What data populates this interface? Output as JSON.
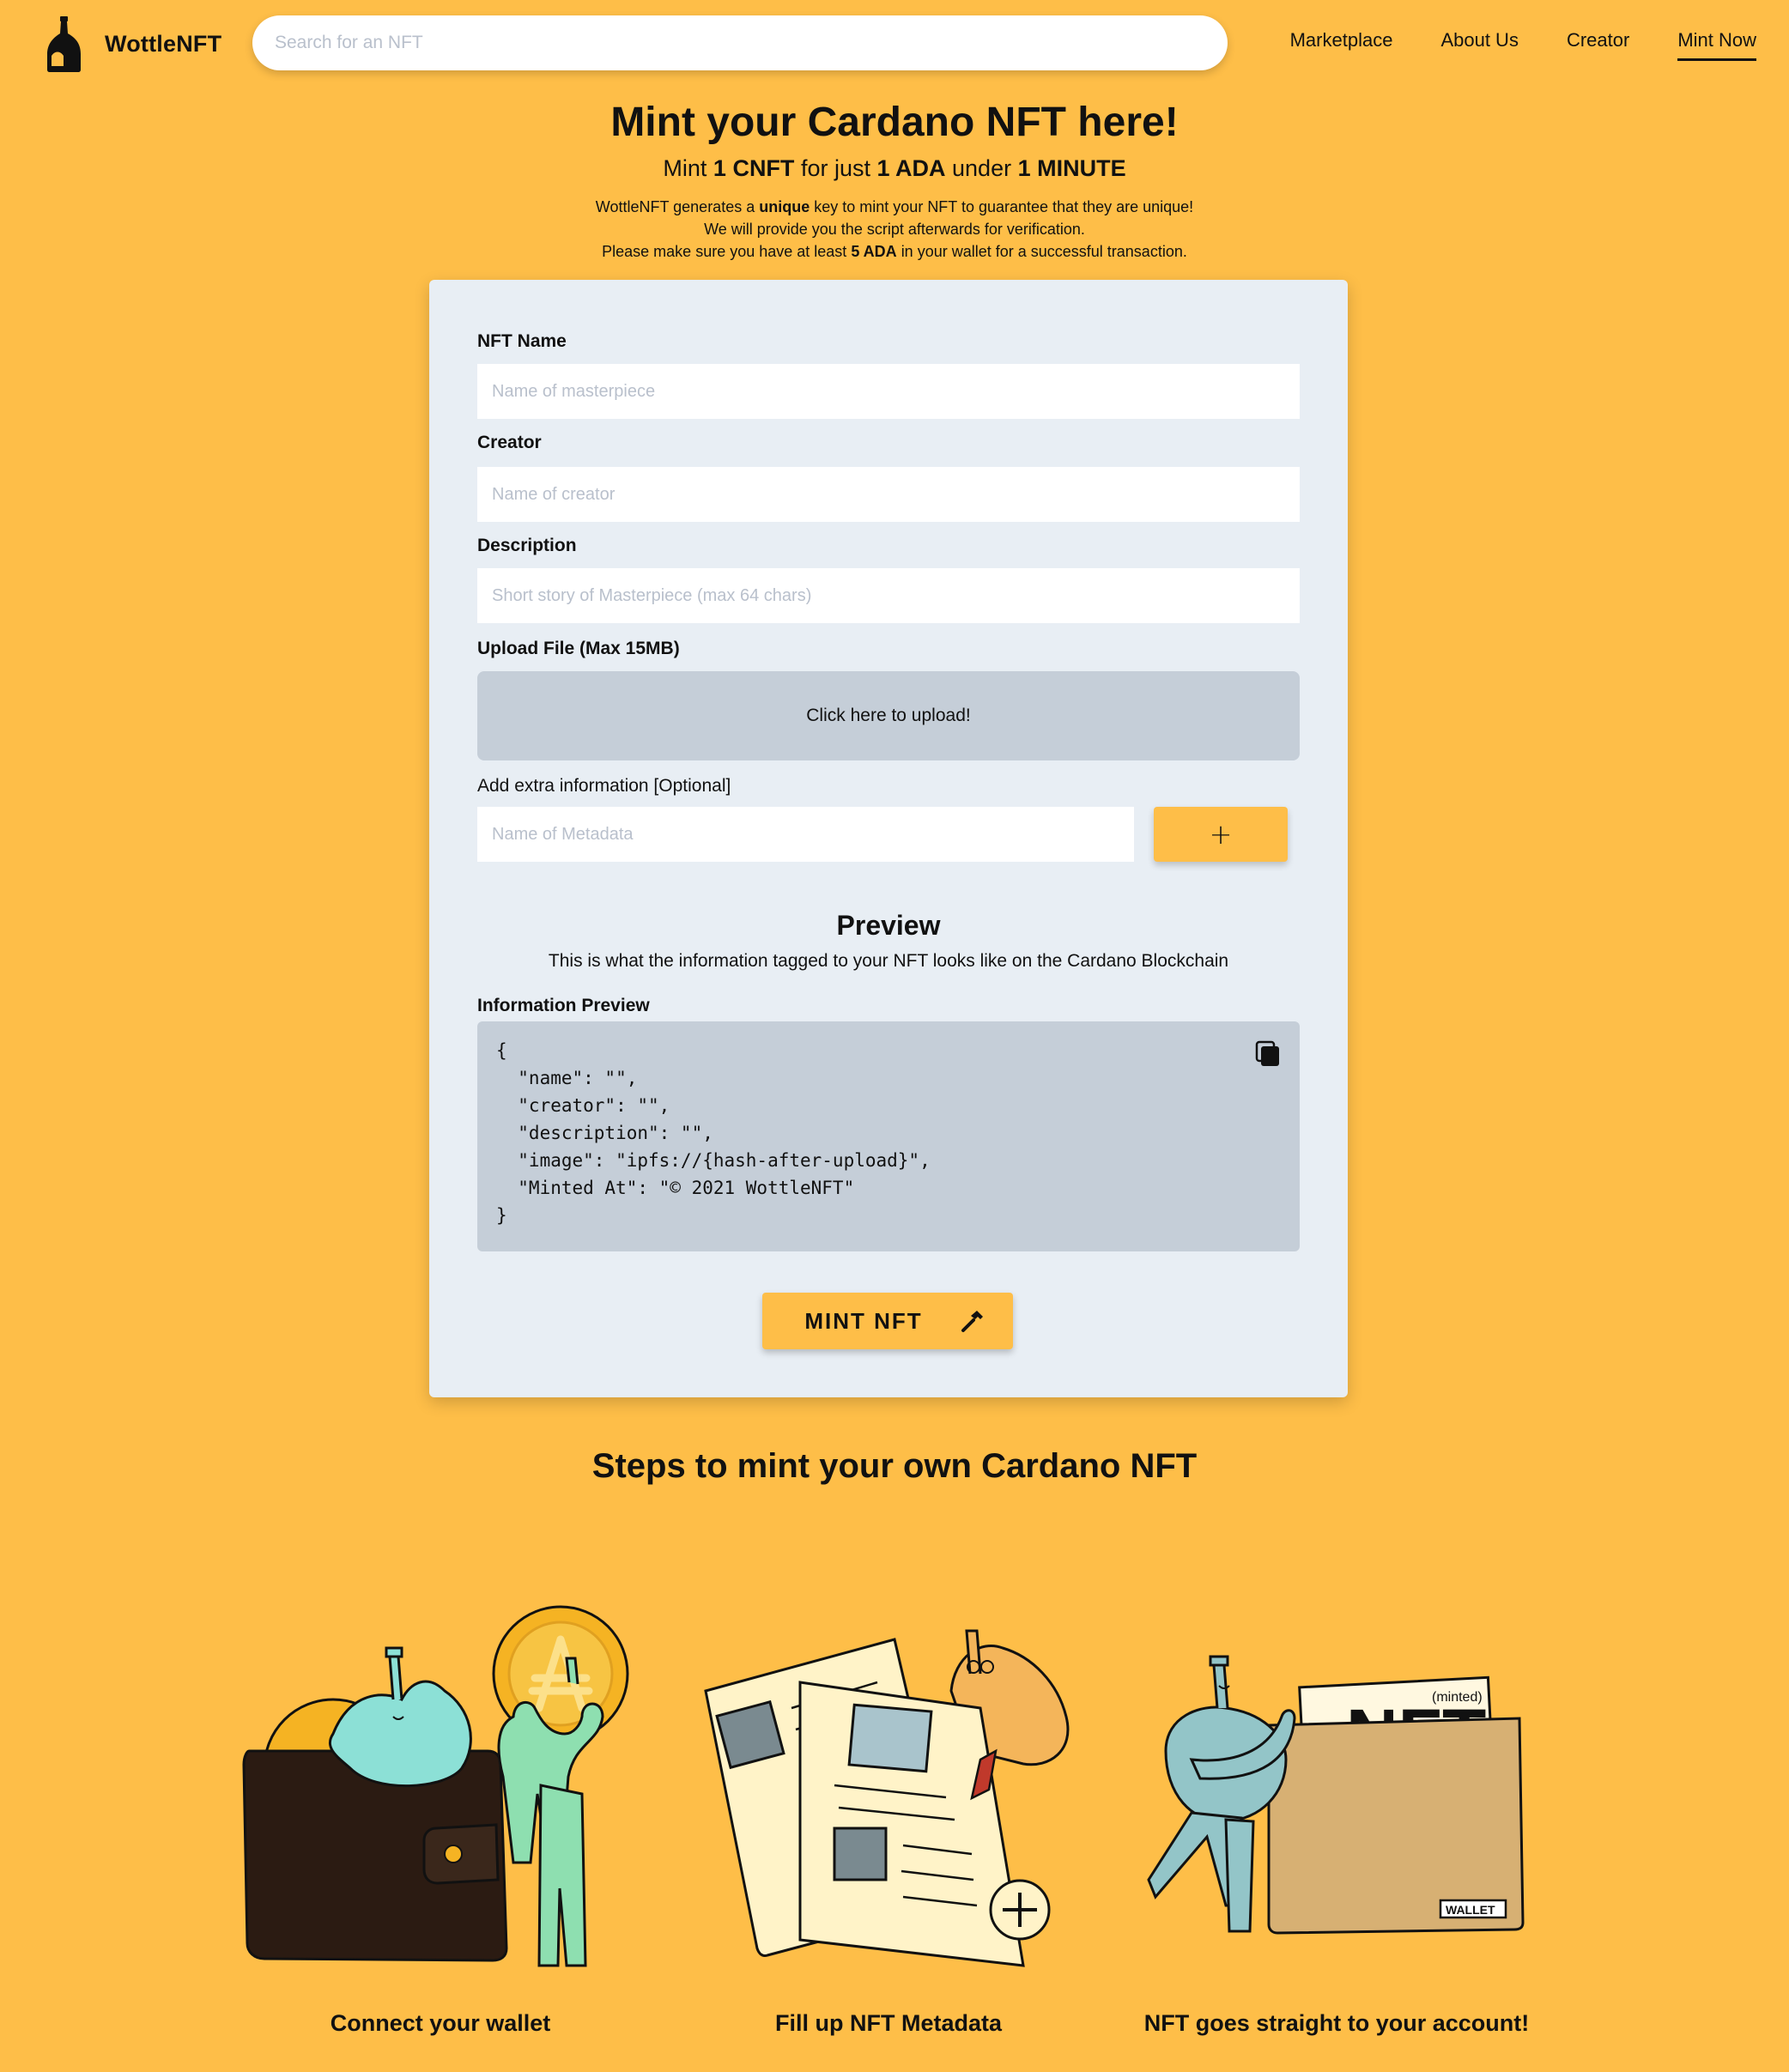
{
  "header": {
    "brand": "WottleNFT",
    "search_placeholder": "Search for an NFT",
    "nav": [
      {
        "label": "Marketplace"
      },
      {
        "label": "About Us"
      },
      {
        "label": "Creator"
      },
      {
        "label": "Mint Now",
        "active": true
      }
    ]
  },
  "hero": {
    "title": "Mint your Cardano NFT here!",
    "sub_mint": "Mint",
    "sub_cnft": "1 CNFT",
    "sub_for": "for just",
    "sub_ada": "1 ADA",
    "sub_under": "under",
    "sub_minute": "1 MINUTE",
    "info1_a": "WottleNFT generates a",
    "info1_b": "unique",
    "info1_c": "key to mint your NFT to guarantee that they are unique!",
    "info2": "We will provide you the script afterwards for verification.",
    "info3_a": "Please make sure you have at least",
    "info3_b": "5 ADA",
    "info3_c": "in your wallet for a successful transaction."
  },
  "form": {
    "name_label": "NFT Name",
    "name_placeholder": "Name of masterpiece",
    "creator_label": "Creator",
    "creator_placeholder": "Name of creator",
    "description_label": "Description",
    "description_placeholder": "Short story of Masterpiece (max 64 chars)",
    "upload_label": "Upload File (Max 15MB)",
    "upload_text": "Click here to upload!",
    "extra_label": "Add extra information [Optional]",
    "metadata_placeholder": "Name of Metadata",
    "add_button": "+",
    "preview_title": "Preview",
    "preview_subtitle": "This is what the information tagged to your NFT looks like on the Cardano Blockchain",
    "info_preview_label": "Information Preview",
    "info_preview_code": "{\n  \"name\": \"\",\n  \"creator\": \"\",\n  \"description\": \"\",\n  \"image\": \"ipfs://{hash-after-upload}\",\n  \"Minted At\": \"© 2021 WottleNFT\"\n}",
    "mint_button": "MINT NFT"
  },
  "steps": {
    "title": "Steps to mint your own Cardano NFT",
    "items": [
      {
        "label": "Connect your wallet",
        "illustration": "wallet-and-ada-coin-illustration"
      },
      {
        "label": "Fill up NFT Metadata",
        "illustration": "metadata-documents-illustration"
      },
      {
        "label": "NFT goes straight to your account!",
        "illustration": "nft-into-wallet-illustration"
      }
    ],
    "illustration_text": {
      "minted": "(minted)",
      "nft": "NFT",
      "wallet": "WALLET"
    }
  },
  "colors": {
    "background": "#FEBE48",
    "card": "#E8EEF4",
    "input_gray": "#C5CED8",
    "accent": "#FEBE48"
  }
}
